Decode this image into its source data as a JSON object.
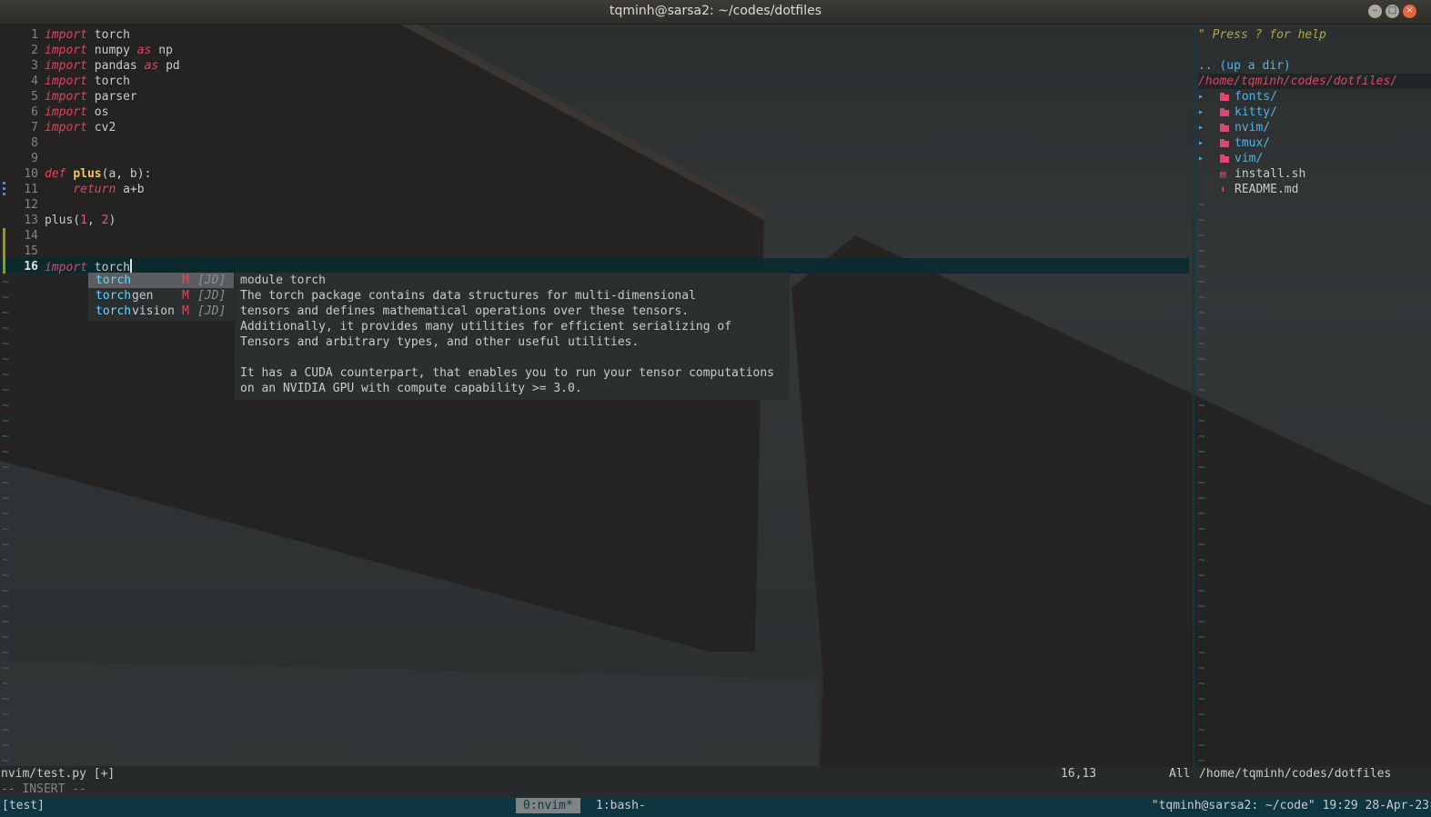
{
  "window": {
    "title": "tqminh@sarsa2: ~/codes/dotfiles",
    "minimize": "–",
    "maximize": "□",
    "close": "×"
  },
  "editor": {
    "lines": [
      {
        "n": "1",
        "kw": "import",
        "rest": " torch"
      },
      {
        "n": "2",
        "kw": "import",
        "mid": " numpy ",
        "kw2": "as",
        "rest": " np"
      },
      {
        "n": "3",
        "kw": "import",
        "mid": " pandas ",
        "kw2": "as",
        "rest": " pd"
      },
      {
        "n": "4",
        "kw": "import",
        "rest": " torch"
      },
      {
        "n": "5",
        "kw": "import",
        "rest": " parser"
      },
      {
        "n": "6",
        "kw": "import",
        "rest": " os"
      },
      {
        "n": "7",
        "kw": "import",
        "rest": " cv2"
      },
      {
        "n": "8"
      },
      {
        "n": "9"
      },
      {
        "n": "10",
        "kw": "def",
        "fn": "plus",
        "rest": "(a, b):"
      },
      {
        "n": "11",
        "indent": "    ",
        "kw": "return",
        "rest": " a+b"
      },
      {
        "n": "12"
      },
      {
        "n": "13",
        "pre": "plus(",
        "num1": "1",
        "sep": ", ",
        "num2": "2",
        "rest": ")"
      },
      {
        "n": "14"
      },
      {
        "n": "15"
      },
      {
        "n": "16",
        "kw": "import",
        "rest": " torch"
      }
    ],
    "tilde": "~"
  },
  "completion": {
    "items": [
      {
        "match": "torch",
        "rest": "",
        "kind": "M",
        "src": "[JD]"
      },
      {
        "match": "torch",
        "rest": "gen",
        "kind": "M",
        "src": "[JD]"
      },
      {
        "match": "torch",
        "rest": "vision",
        "kind": "M",
        "src": "[JD]"
      }
    ],
    "doc": [
      "module torch",
      "The torch package contains data structures for multi-dimensional",
      "tensors and defines mathematical operations over these tensors.",
      "Additionally, it provides many utilities for efficient serializing of",
      "Tensors and arbitrary types, and other useful utilities.",
      "",
      "It has a CUDA counterpart, that enables you to run your tensor computations",
      "on an NVIDIA GPU with compute capability >= 3.0."
    ]
  },
  "tree": {
    "help": "\" Press ? for help",
    "up": ".. (up a dir)",
    "cwd": "/home/tqminh/codes/dotfiles/",
    "arrow": "▸",
    "folders": [
      "fonts/",
      "kitty/",
      "nvim/",
      "tmux/",
      "vim/"
    ],
    "files": [
      {
        "icon": "▤",
        "name": "install.sh"
      },
      {
        "icon": "⬇",
        "name": "README.md"
      }
    ]
  },
  "status": {
    "file": "nvim/test.py [+]",
    "pos": "16,13",
    "scroll": "All",
    "tree_path": "/home/tqminh/codes/dotfiles",
    "mode": "-- INSERT --"
  },
  "tmux": {
    "session": "[test]",
    "win0": "0:nvim*",
    "win1": "1:bash-",
    "right": "\"tqminh@sarsa2: ~/code\" 19:29 28-Apr-23"
  },
  "colors": {
    "keyword": "#e0445f",
    "function": "#f2c94c",
    "number": "#e8508a",
    "match": "#5fd7ff",
    "tree_dir": "#4fb3e8",
    "tree_path": "#e0445f"
  }
}
